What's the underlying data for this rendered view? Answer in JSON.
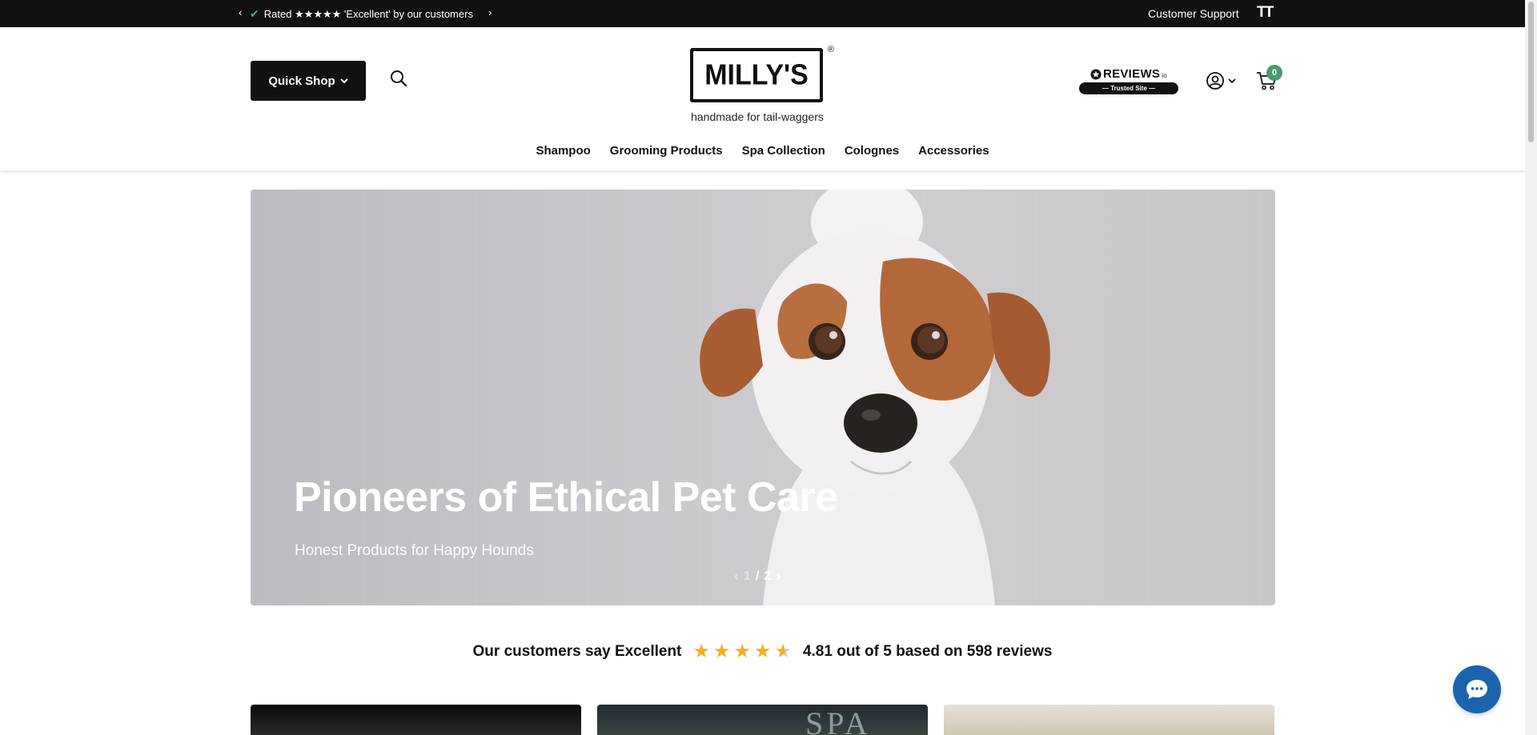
{
  "announcement": {
    "message": "Rated ★★★★★ 'Excellent' by our customers",
    "support_label": "Customer Support",
    "text_size_label": "TT"
  },
  "header": {
    "quick_shop_label": "Quick Shop",
    "logo_text": "MILLY'S",
    "logo_registered": "®",
    "tagline": "handmade for tail-waggers",
    "reviews_badge": {
      "brand": "REVIEWS",
      "suffix": "io",
      "pill": "— Trusted Site —"
    },
    "cart_count": "0"
  },
  "nav": [
    "Shampoo",
    "Grooming Products",
    "Spa Collection",
    "Colognes",
    "Accessories"
  ],
  "hero": {
    "title": "Pioneers of Ethical Pet Care",
    "subtitle": "Honest Products for Happy Hounds",
    "slide_current": "1",
    "slide_separator": "/",
    "slide_total": "2"
  },
  "reviews_summary": {
    "lead": "Our customers say Excellent",
    "rating_text": "4.81 out of 5 based on 598 reviews",
    "rating": 4.81,
    "rating_max": 5
  },
  "cards": {
    "spa_text": "SPA"
  },
  "colors": {
    "dark": "#111111",
    "accent_green": "#4a9a6e",
    "star": "#f2b01e",
    "chat_blue": "#1c63ad"
  }
}
